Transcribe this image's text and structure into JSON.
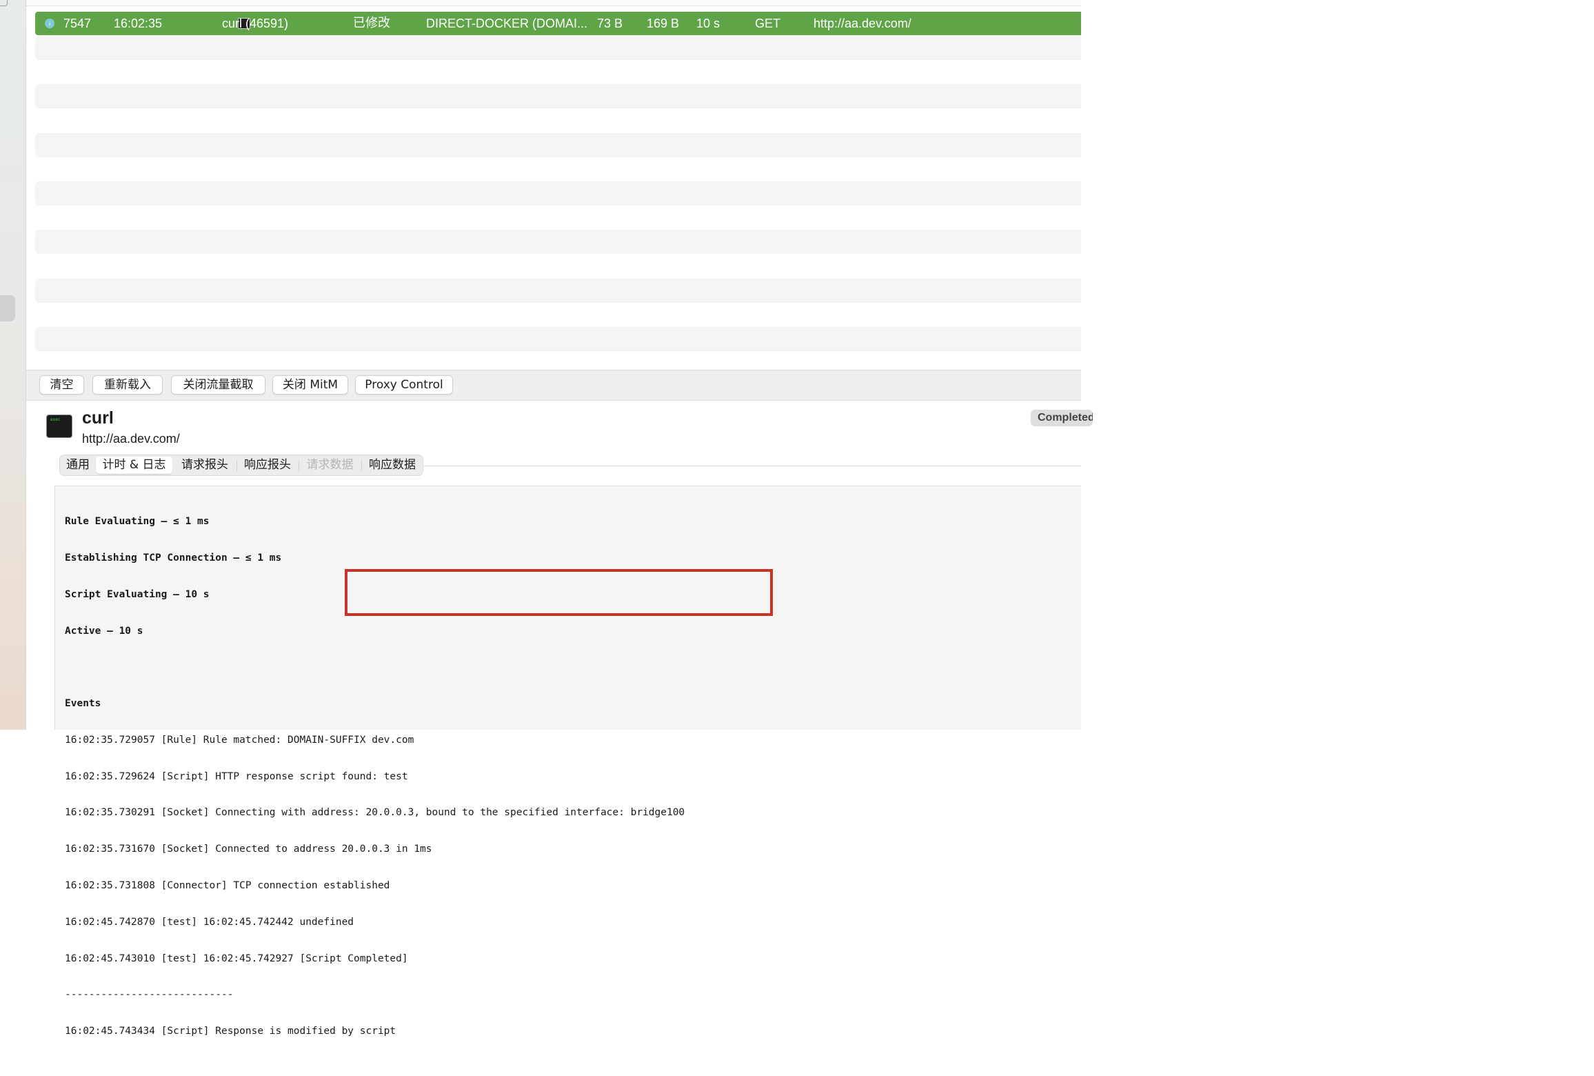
{
  "request_row": {
    "id": "7547",
    "time": "16:02:35",
    "client": "curl (46591)",
    "status": "已修改",
    "policy": "DIRECT-DOCKER (DOMAI...",
    "upload": "73 B",
    "download": "169 B",
    "duration": "10 s",
    "method": "GET",
    "url": "http://aa.dev.com/",
    "row_color": "#5fa547"
  },
  "toolbar": {
    "clear_label": "清空",
    "reload_label": "重新载入",
    "stop_capture_label": "关闭流量截取",
    "stop_mitm_label": "关闭 MitM",
    "proxy_control_label": "Proxy Control"
  },
  "detail": {
    "app_icon_text": "exec",
    "title": "curl",
    "url": "http://aa.dev.com/",
    "status": "Completed"
  },
  "tabs": [
    {
      "label": "通用"
    },
    {
      "label": "计时 & 日志"
    },
    {
      "label": "请求报头"
    },
    {
      "label": "响应报头"
    },
    {
      "label": "请求数据"
    },
    {
      "label": "响应数据"
    }
  ],
  "log": {
    "timing": [
      "Rule Evaluating – ≤ 1 ms",
      "Establishing TCP Connection – ≤ 1 ms",
      "Script Evaluating – 10 s",
      "Active – 10 s"
    ],
    "events_header": "Events",
    "events": [
      "16:02:35.729057 [Rule] Rule matched: DOMAIN-SUFFIX dev.com",
      "16:02:35.729624 [Script] HTTP response script found: test",
      "16:02:35.730291 [Socket] Connecting with address: 20.0.0.3, bound to the specified interface: bridge100",
      "16:02:35.731670 [Socket] Connected to address 20.0.0.3 in 1ms",
      "16:02:35.731808 [Connector] TCP connection established",
      "16:02:45.742870 [test] 16:02:45.742442 undefined",
      "16:02:45.743010 [test] 16:02:45.742927 [Script Completed]"
    ],
    "separator": "----------------------------",
    "footer": "16:02:45.743434 [Script] Response is modified by script"
  },
  "highlight_color": "#cc3326"
}
